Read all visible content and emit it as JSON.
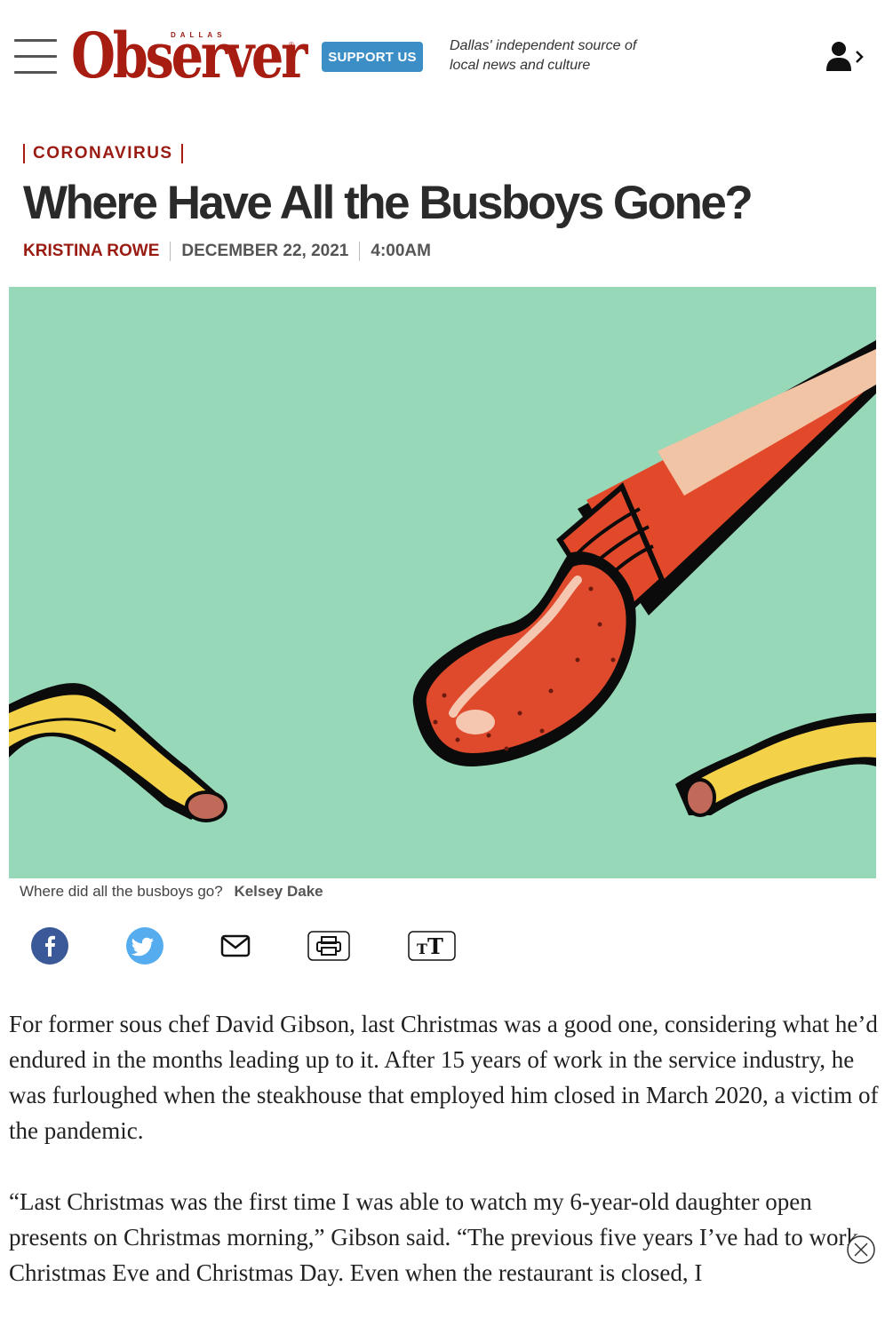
{
  "header": {
    "logo_small": "DALLAS",
    "logo_text": "Observer",
    "support_label": "SUPPORT US",
    "tagline_line1": "Dallas' independent source of",
    "tagline_line2": "local news and culture"
  },
  "article": {
    "category": "CORONAVIRUS",
    "title": "Where Have All the Busboys Gone?",
    "author": "KRISTINA ROWE",
    "date": "DECEMBER 22, 2021",
    "time": "4:00AM",
    "caption": "Where did all the busboys go?",
    "credit": "Kelsey Dake",
    "paragraphs": [
      "For former sous chef David Gibson, last Christmas was a good one, considering what he’d endured in the months leading up to it. After 15 years of work in the service industry, he was furloughed when the steakhouse that employed him closed in March 2020, a victim of the pandemic.",
      "“Last Christmas was the first time I was able to watch my 6-year-old daughter open presents on Christmas morning,” Gibson said. “The previous five years I’ve had to work Christmas Eve and Christmas Day. Even when the restaurant is closed, I"
    ]
  },
  "share": {
    "facebook_icon": "facebook-icon",
    "twitter_icon": "twitter-icon",
    "email_icon": "email-icon",
    "print_icon": "print-icon",
    "text_size_icon": "text-size-icon"
  },
  "colors": {
    "brand_red": "#a71d12",
    "support_blue": "#3c8ec6",
    "facebook_blue": "#3b5998",
    "twitter_blue": "#55acee",
    "hero_bg": "#97d8b9"
  }
}
